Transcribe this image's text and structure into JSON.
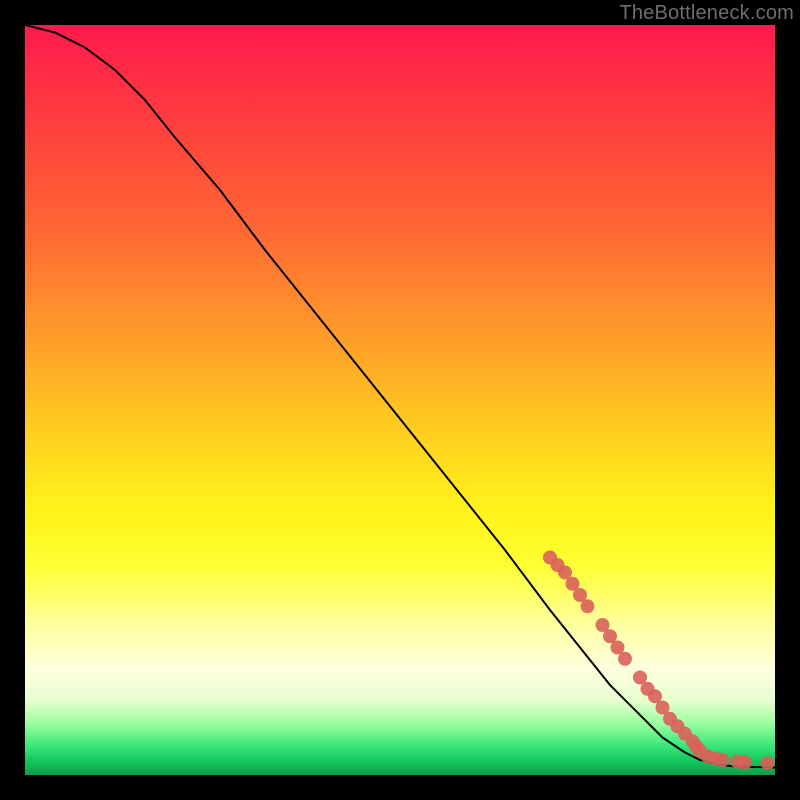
{
  "watermark": "TheBottleneck.com",
  "chart_data": {
    "type": "line",
    "title": "",
    "xlabel": "",
    "ylabel": "",
    "xlim": [
      0,
      100
    ],
    "ylim": [
      0,
      100
    ],
    "grid": false,
    "legend": false,
    "series": [
      {
        "name": "curve",
        "style": "line",
        "color": "#000000",
        "x": [
          0,
          4,
          8,
          12,
          16,
          20,
          26,
          32,
          40,
          48,
          56,
          64,
          70,
          74,
          78,
          82,
          85,
          88,
          90,
          92,
          94,
          96,
          98,
          100
        ],
        "y": [
          100,
          99,
          97,
          94,
          90,
          85,
          78,
          70,
          60,
          50,
          40,
          30,
          22,
          17,
          12,
          8,
          5,
          3,
          2,
          1.5,
          1.2,
          1.1,
          1.05,
          1
        ]
      },
      {
        "name": "highlighted-points",
        "style": "scatter",
        "color": "#d9605a",
        "x": [
          70,
          71,
          72,
          73,
          74,
          75,
          77,
          78,
          79,
          80,
          82,
          83,
          84,
          85,
          86,
          87,
          88,
          89,
          89.5,
          90,
          91,
          92,
          93,
          95,
          96,
          99
        ],
        "y": [
          29,
          28,
          27,
          25.5,
          24,
          22.5,
          20,
          18.5,
          17,
          15.5,
          13,
          11.5,
          10.5,
          9,
          7.5,
          6.5,
          5.5,
          4.5,
          3.8,
          3.2,
          2.5,
          2.2,
          2.0,
          1.8,
          1.7,
          1.6
        ]
      }
    ]
  }
}
